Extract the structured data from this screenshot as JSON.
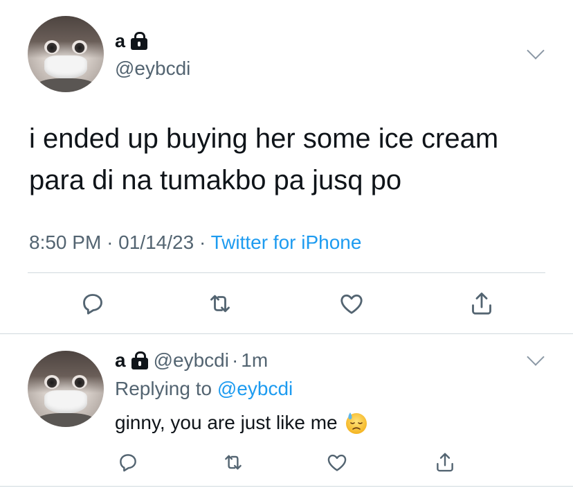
{
  "main_tweet": {
    "author_name": "a",
    "author_handle": "@eybcdi",
    "text_line1": "i ended up buying her some ice cream",
    "text_line2": "para di na tumakbo pa jusq po",
    "time": "8:50 PM",
    "date": "01/14/23",
    "separator": "·",
    "source": "Twitter for iPhone"
  },
  "reply_tweet": {
    "author_name": "a",
    "author_handle": "@eybcdi",
    "separator": "·",
    "time_ago": "1m",
    "replying_prefix": "Replying to",
    "replying_handle": "@eybcdi",
    "text": "ginny, you are just like me"
  },
  "icons": {
    "protected": "lock-icon",
    "more": "chevron-down-icon",
    "reply": "reply-icon",
    "retweet": "retweet-icon",
    "like": "heart-icon",
    "share": "share-icon",
    "emoji": "downcast-face-with-sweat-emoji"
  },
  "colors": {
    "text": "#0f1419",
    "secondary": "#536471",
    "link": "#1d9bf0",
    "divider": "#cfd9de",
    "icon": "#536471"
  }
}
